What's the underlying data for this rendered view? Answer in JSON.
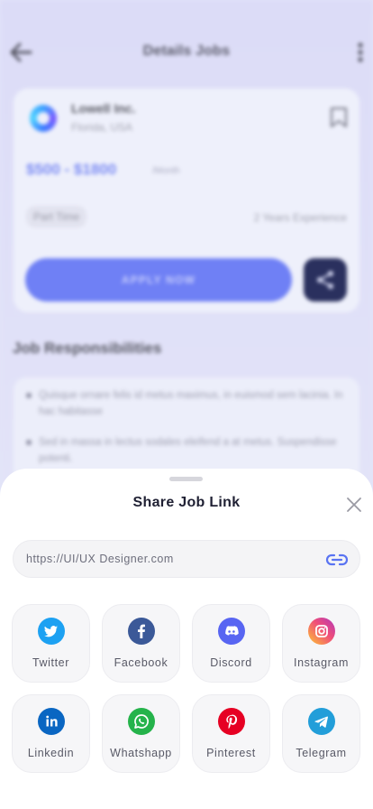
{
  "background": {
    "header_title": "Details Jobs",
    "company": {
      "name": "Lowell Inc.",
      "location": "Florida, USA"
    },
    "salary": "$500 - $1800",
    "salary_unit": "/Month",
    "job_type": "Part Time",
    "experience": "2 Years Experience",
    "apply_label": "APPLY NOW",
    "responsibilities": {
      "title": "Job Responsibilities",
      "items": [
        "Quisque ornare felis id metus maximus, in euismod sem lacinia. In hac habitasse",
        "Sed in massa in lectus sodales eleifend a at metus. Suspendisse potenti."
      ]
    }
  },
  "sheet": {
    "title": "Share Job Link",
    "link": "https://UI/UX Designer.com",
    "socials": [
      {
        "label": "Twitter",
        "icon": "twitter-icon",
        "color": "#1da1f2"
      },
      {
        "label": "Facebook",
        "icon": "facebook-icon",
        "color": "#3b5998"
      },
      {
        "label": "Discord",
        "icon": "discord-icon",
        "color": "#5865f2"
      },
      {
        "label": "Instagram",
        "icon": "instagram-icon",
        "color": "#e1306c"
      },
      {
        "label": "Linkedin",
        "icon": "linkedin-icon",
        "color": "#0a66c2"
      },
      {
        "label": "Whatshapp",
        "icon": "whatsapp-icon",
        "color": "#25d366"
      },
      {
        "label": "Pinterest",
        "icon": "pinterest-icon",
        "color": "#e60023"
      },
      {
        "label": "Telegram",
        "icon": "telegram-icon",
        "color": "#229ed9"
      }
    ]
  }
}
